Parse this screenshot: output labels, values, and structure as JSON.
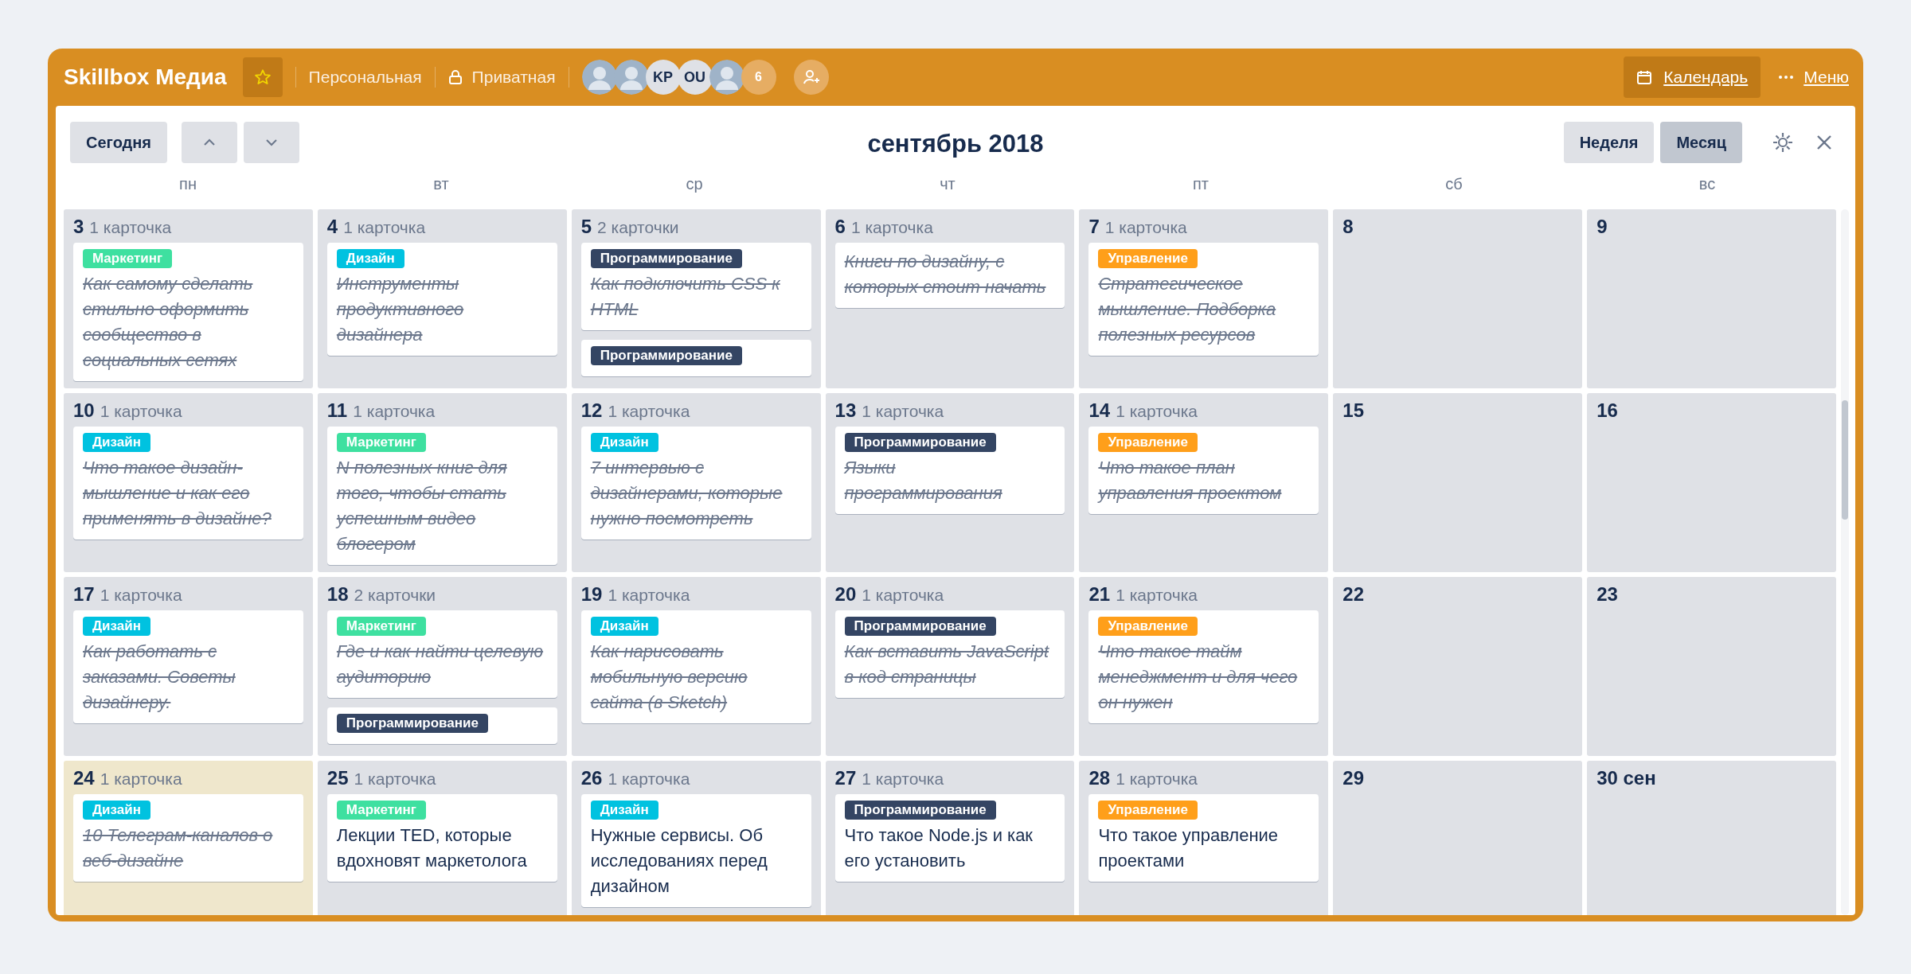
{
  "board": {
    "title": "Skillbox Медиа",
    "starred": true,
    "team": "Персональная",
    "visibility": "Приватная",
    "members": [
      {
        "kind": "photo"
      },
      {
        "kind": "photo"
      },
      {
        "kind": "initials",
        "text": "KP"
      },
      {
        "kind": "initials",
        "text": "OU"
      },
      {
        "kind": "photo"
      },
      {
        "kind": "count",
        "text": "6"
      }
    ],
    "calendar_button": "Календарь",
    "menu": "Меню"
  },
  "calendar": {
    "today_button": "Сегодня",
    "title": "сентябрь 2018",
    "views": [
      {
        "label": "Неделя",
        "selected": false
      },
      {
        "label": "Месяц",
        "selected": true
      }
    ],
    "weekdays": [
      "пн",
      "вт",
      "ср",
      "чт",
      "пт",
      "сб",
      "вс"
    ],
    "weeks": [
      [
        {
          "day": "3",
          "count": "1 карточка",
          "today": false,
          "cards": [
            {
              "label": "Маркетинг",
              "color": "#3ee0a0",
              "title": "Как самому сделать стильно оформить сообщество в социальных сетях",
              "done": true
            }
          ]
        },
        {
          "day": "4",
          "count": "1 карточка",
          "today": false,
          "cards": [
            {
              "label": "Дизайн",
              "color": "#00c2e0",
              "title": "Инструменты продуктивного дизайнера",
              "done": true
            }
          ]
        },
        {
          "day": "5",
          "count": "2 карточки",
          "today": false,
          "cards": [
            {
              "label": "Программирование",
              "color": "#344563",
              "title": "Как подключить CSS к HTML",
              "done": true
            },
            {
              "label": "Программирование",
              "color": "#344563"
            }
          ]
        },
        {
          "day": "6",
          "count": "1 карточка",
          "today": false,
          "cards": [
            {
              "title": "Книги по дизайну, с которых стоит начать",
              "done": true
            }
          ]
        },
        {
          "day": "7",
          "count": "1 карточка",
          "today": false,
          "cards": [
            {
              "label": "Управление",
              "color": "#ff9f1a",
              "title": "Стратегическое мышление. Подборка полезных ресурсов",
              "done": true
            }
          ]
        },
        {
          "day": "8",
          "today": false
        },
        {
          "day": "9",
          "today": false
        }
      ],
      [
        {
          "day": "10",
          "count": "1 карточка",
          "today": false,
          "cards": [
            {
              "label": "Дизайн",
              "color": "#00c2e0",
              "title": "Что такое дизайн-мышление и как его применять в дизайне?",
              "done": true
            }
          ]
        },
        {
          "day": "11",
          "count": "1 карточка",
          "today": false,
          "cards": [
            {
              "label": "Маркетинг",
              "color": "#3ee0a0",
              "title": "N полезных книг для того, чтобы стать успешным видео блогером",
              "done": true
            }
          ]
        },
        {
          "day": "12",
          "count": "1 карточка",
          "today": false,
          "cards": [
            {
              "label": "Дизайн",
              "color": "#00c2e0",
              "title": "7 интервью с дизайнерами, которые нужно посмотреть",
              "done": true
            }
          ]
        },
        {
          "day": "13",
          "count": "1 карточка",
          "today": false,
          "cards": [
            {
              "label": "Программирование",
              "color": "#344563",
              "title": "Языки программирования",
              "done": true
            }
          ]
        },
        {
          "day": "14",
          "count": "1 карточка",
          "today": false,
          "cards": [
            {
              "label": "Управление",
              "color": "#ff9f1a",
              "title": "Что такое план управления проектом",
              "done": true
            }
          ]
        },
        {
          "day": "15",
          "today": false
        },
        {
          "day": "16",
          "today": false
        }
      ],
      [
        {
          "day": "17",
          "count": "1 карточка",
          "today": false,
          "cards": [
            {
              "label": "Дизайн",
              "color": "#00c2e0",
              "title": "Как работать с заказами. Советы дизайнеру.",
              "done": true
            }
          ]
        },
        {
          "day": "18",
          "count": "2 карточки",
          "today": false,
          "cards": [
            {
              "label": "Маркетинг",
              "color": "#3ee0a0",
              "title": "Где и как найти целевую аудиторию",
              "done": true
            },
            {
              "label": "Программирование",
              "color": "#344563"
            }
          ]
        },
        {
          "day": "19",
          "count": "1 карточка",
          "today": false,
          "cards": [
            {
              "label": "Дизайн",
              "color": "#00c2e0",
              "title": "Как нарисовать мобильную версию сайта (в Sketch)",
              "done": true
            }
          ]
        },
        {
          "day": "20",
          "count": "1 карточка",
          "today": false,
          "cards": [
            {
              "label": "Программирование",
              "color": "#344563",
              "title": "Как вставить JavaScript в код страницы",
              "done": true
            }
          ]
        },
        {
          "day": "21",
          "count": "1 карточка",
          "today": false,
          "cards": [
            {
              "label": "Управление",
              "color": "#ff9f1a",
              "title": "Что такое тайм менеджмент и для чего он нужен",
              "done": true
            }
          ]
        },
        {
          "day": "22",
          "today": false
        },
        {
          "day": "23",
          "today": false
        }
      ],
      [
        {
          "day": "24",
          "count": "1 карточка",
          "today": true,
          "cards": [
            {
              "label": "Дизайн",
              "color": "#00c2e0",
              "title": "10 Телеграм-каналов о веб-дизайне",
              "done": true
            }
          ]
        },
        {
          "day": "25",
          "count": "1 карточка",
          "today": false,
          "cards": [
            {
              "label": "Маркетинг",
              "color": "#3ee0a0",
              "title": "Лекции TED, которые вдохновят маркетолога",
              "done": false
            }
          ]
        },
        {
          "day": "26",
          "count": "1 карточка",
          "today": false,
          "cards": [
            {
              "label": "Дизайн",
              "color": "#00c2e0",
              "title": "Нужные сервисы. Об исследованиях перед дизайном",
              "done": false
            }
          ]
        },
        {
          "day": "27",
          "count": "1 карточка",
          "today": false,
          "cards": [
            {
              "label": "Программирование",
              "color": "#344563",
              "title": "Что такое Node.js и как его установить",
              "done": false
            }
          ]
        },
        {
          "day": "28",
          "count": "1 карточка",
          "today": false,
          "cards": [
            {
              "label": "Управление",
              "color": "#ff9f1a",
              "title": "Что такое управление проектами",
              "done": false
            }
          ]
        },
        {
          "day": "29",
          "today": false
        },
        {
          "day": "30 сен",
          "today": false
        }
      ]
    ]
  }
}
